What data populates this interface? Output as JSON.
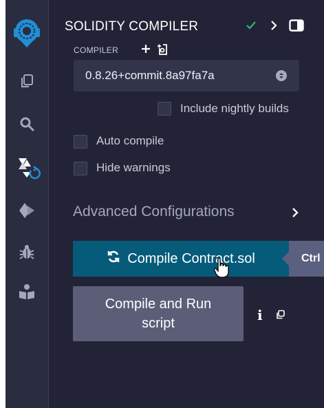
{
  "header": {
    "title": "SOLIDITY COMPILER",
    "icons": [
      "check-icon",
      "chevron-right-icon",
      "panel-toggle-icon"
    ]
  },
  "icon_rail": {
    "items": [
      "remix-logo-icon",
      "file-explorer-icon",
      "search-icon",
      "solidity-compiler-icon",
      "deploy-run-icon",
      "debugger-icon",
      "learneth-icon"
    ]
  },
  "compiler": {
    "label": "COMPILER",
    "version": "0.8.26+commit.8a97fa7a",
    "nightly_label": "Include nightly builds",
    "nightly_checked": false
  },
  "options": [
    {
      "label": "Auto compile",
      "checked": false
    },
    {
      "label": "Hide warnings",
      "checked": false
    }
  ],
  "advanced": {
    "label": "Advanced Configurations"
  },
  "compile_button": {
    "label": "Compile Contract.sol",
    "shortcut": "Ctrl"
  },
  "run_button": {
    "line1": "Compile and Run",
    "line2": "script"
  },
  "info": {
    "label": "i"
  },
  "colors": {
    "background": "#222336",
    "icon_bar": "#2a2c3f",
    "accent_blue": "#065b7a",
    "success_green": "#2eb673",
    "secondary_button": "#5c5e78"
  }
}
